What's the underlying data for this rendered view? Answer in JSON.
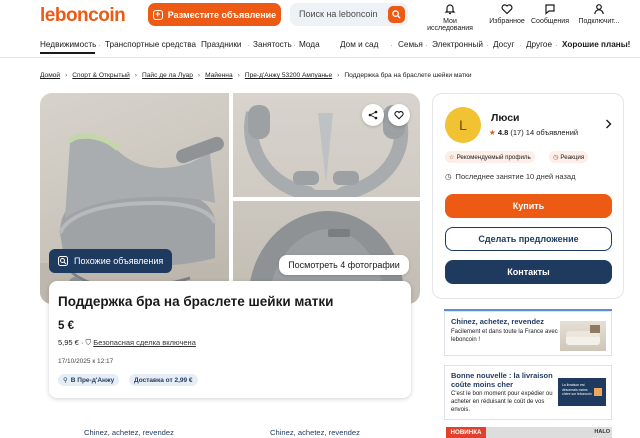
{
  "brand": {
    "logo": "leboncoin",
    "accent": "#ec5a13",
    "navy": "#1e3a5f"
  },
  "header": {
    "post_label": "Разместите объявление",
    "search_placeholder": "Поиск на leboncoin",
    "nav": [
      {
        "label": "Мои исследования",
        "icon": "bell-icon"
      },
      {
        "label": "Избранное",
        "icon": "heart-icon"
      },
      {
        "label": "Сообщения",
        "icon": "chat-icon"
      },
      {
        "label": "Подключит...",
        "icon": "user-icon"
      }
    ]
  },
  "categories": [
    "Недвижимость",
    "Транспортные средства",
    "Праздники",
    "Занятость",
    "Мода",
    "Дом и сад",
    "Семья",
    "Электронный",
    "Досуг",
    "Другое",
    "Хорошие планы!"
  ],
  "breadcrumb": [
    "Домой",
    "Спорт & Открытый",
    "Пайс де ла Луар",
    "Майенна",
    "Пре-д'Анжу 53200 Ампуанье",
    "Поддержка бра на браслете шейки матки"
  ],
  "gallery": {
    "similar_label": "Похожие объявления",
    "photos_label": "Посмотреть 4 фотографии"
  },
  "listing": {
    "title": "Поддержка бра на браслете шейки матки",
    "price": "5 €",
    "price_with_fee": "5,95 €",
    "safe_label": "Безопасная сделка включена",
    "date": "17/10/2025 к 12:17",
    "location_tag": "В Пре-д'Анжу",
    "delivery_tag": "Доставка от 2,99 €"
  },
  "seller": {
    "initial": "L",
    "name": "Люси",
    "rating": "4.8",
    "reviews": "(17)",
    "ads_count": "14 объявлений",
    "badge_recommended": "Рекомендуемый профиль",
    "badge_reaction": "Реакция",
    "last_seen": "Последнее занятие 10 дней назад",
    "buy_label": "Купить",
    "offer_label": "Сделать предложение",
    "contact_label": "Контакты"
  },
  "ads": [
    {
      "title": "Chinez, achetez, revendez",
      "text": "Facilement et dans toute la France avec leboncoin !"
    },
    {
      "title": "Bonne nouvelle : la livraison",
      "title2": "coûte moins cher",
      "text": "C'est le bon moment pour expédier ou acheter en réduisant le coût de vos envois.",
      "img_text": "La livraison est désormais moins chère sur leboncoin"
    }
  ],
  "bottom_ad": {
    "tag": "НОВИНКА",
    "brand": "HALO"
  },
  "footer_links": [
    "Chinez, achetez, revendez",
    "Chinez, achetez, revendez"
  ]
}
